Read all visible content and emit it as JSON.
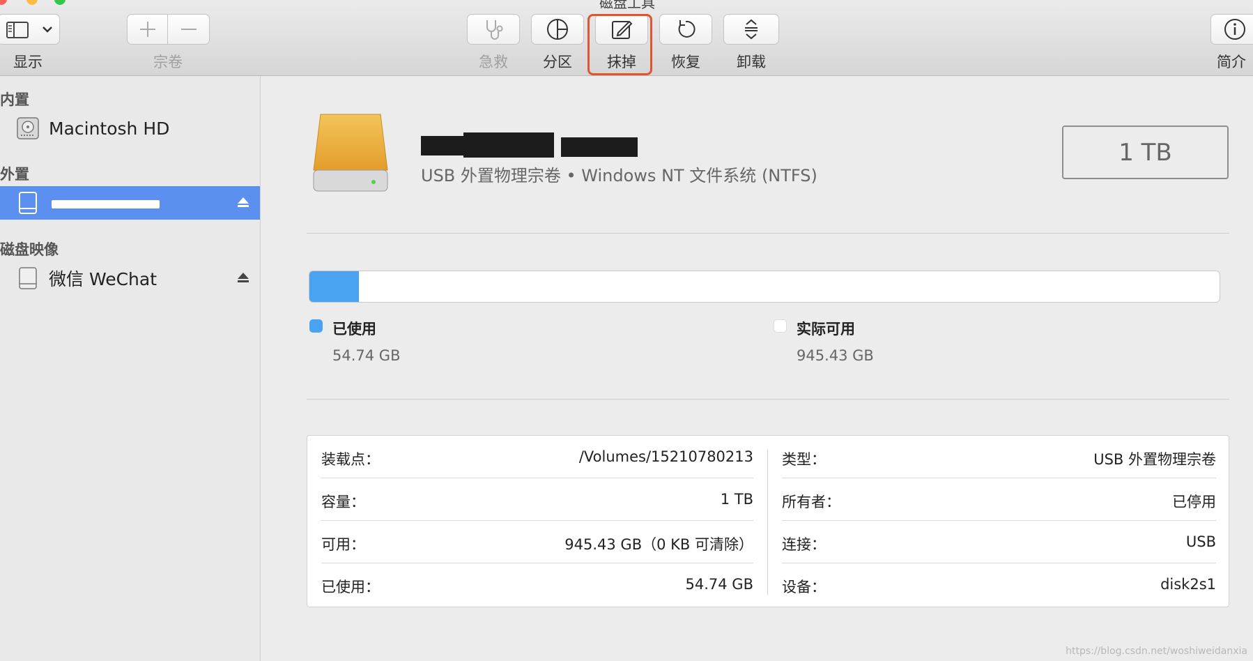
{
  "window": {
    "title": "磁盘工具"
  },
  "toolbar": {
    "view_label": "显示",
    "volume_label": "宗卷",
    "firstaid_label": "急救",
    "partition_label": "分区",
    "erase_label": "抹掉",
    "restore_label": "恢复",
    "unmount_label": "卸载",
    "info_label": "简介"
  },
  "sidebar": {
    "internal_header": "内置",
    "internal_items": [
      {
        "label": "Macintosh HD"
      }
    ],
    "external_header": "外置",
    "external_items": [
      {
        "label": ""
      }
    ],
    "images_header": "磁盘映像",
    "image_items": [
      {
        "label": "微信 WeChat"
      }
    ]
  },
  "volume": {
    "subtitle": "USB 外置物理宗卷 • Windows NT 文件系统 (NTFS)",
    "size": "1 TB",
    "used_fraction": 0.0547
  },
  "usage": {
    "used_label": "已使用",
    "used_value": "54.74 GB",
    "available_label": "实际可用",
    "available_value": "945.43 GB"
  },
  "colors": {
    "used": "#4aa3f0",
    "selected": "#5b8ff0",
    "highlight": "#e2542f"
  },
  "info": {
    "left": [
      {
        "key": "装载点：",
        "value": "/Volumes/15210780213"
      },
      {
        "key": "容量：",
        "value": "1 TB"
      },
      {
        "key": "可用：",
        "value": "945.43 GB（0 KB 可清除）"
      },
      {
        "key": "已使用：",
        "value": "54.74 GB"
      }
    ],
    "right": [
      {
        "key": "类型：",
        "value": "USB 外置物理宗卷"
      },
      {
        "key": "所有者：",
        "value": "已停用"
      },
      {
        "key": "连接：",
        "value": "USB"
      },
      {
        "key": "设备：",
        "value": "disk2s1"
      }
    ]
  },
  "watermark": "https://blog.csdn.net/woshiweidanxia"
}
